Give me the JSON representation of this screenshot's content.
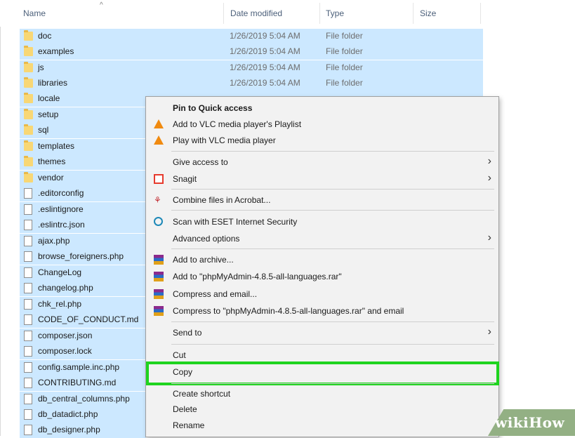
{
  "columns": {
    "name": "Name",
    "date": "Date modified",
    "type": "Type",
    "size": "Size"
  },
  "folders": [
    {
      "name": "doc",
      "date": "1/26/2019 5:04 AM",
      "type": "File folder"
    },
    {
      "name": "examples",
      "date": "1/26/2019 5:04 AM",
      "type": "File folder"
    },
    {
      "name": "js",
      "date": "1/26/2019 5:04 AM",
      "type": "File folder"
    },
    {
      "name": "libraries",
      "date": "1/26/2019 5:04 AM",
      "type": "File folder"
    },
    {
      "name": "locale"
    },
    {
      "name": "setup"
    },
    {
      "name": "sql"
    },
    {
      "name": "templates"
    },
    {
      "name": "themes"
    },
    {
      "name": "vendor"
    }
  ],
  "files": [
    ".editorconfig",
    ".eslintignore",
    ".eslintrc.json",
    "ajax.php",
    "browse_foreigners.php",
    "ChangeLog",
    "changelog.php",
    "chk_rel.php",
    "CODE_OF_CONDUCT.md",
    "composer.json",
    "composer.lock",
    "config.sample.inc.php",
    "CONTRIBUTING.md",
    "db_central_columns.php",
    "db_datadict.php",
    "db_designer.php"
  ],
  "context_menu": {
    "pin": "Pin to Quick access",
    "vlc_add": "Add to VLC media player's Playlist",
    "vlc_play": "Play with VLC media player",
    "give_access": "Give access to",
    "snagit": "Snagit",
    "acrobat": "Combine files in Acrobat...",
    "eset": "Scan with ESET Internet Security",
    "advanced": "Advanced options",
    "add_archive": "Add to archive...",
    "add_rar": "Add to \"phpMyAdmin-4.8.5-all-languages.rar\"",
    "compress_email": "Compress and email...",
    "compress_rar_email": "Compress to \"phpMyAdmin-4.8.5-all-languages.rar\" and email",
    "send_to": "Send to",
    "cut": "Cut",
    "copy": "Copy",
    "create_shortcut": "Create shortcut",
    "delete": "Delete",
    "rename": "Rename"
  },
  "icons": {
    "folder": "folder-icon",
    "file": "file-icon",
    "vlc": "vlc-icon",
    "snagit": "snagit-icon",
    "acrobat": "acrobat-icon",
    "eset": "eset-icon",
    "winrar": "winrar-icon",
    "submenu": "chevron-right-icon"
  },
  "colors": {
    "selection": "#cce8ff",
    "highlight": "#1fd41f",
    "menu_bg": "#f2f2f2"
  },
  "watermark": "wikiHow"
}
